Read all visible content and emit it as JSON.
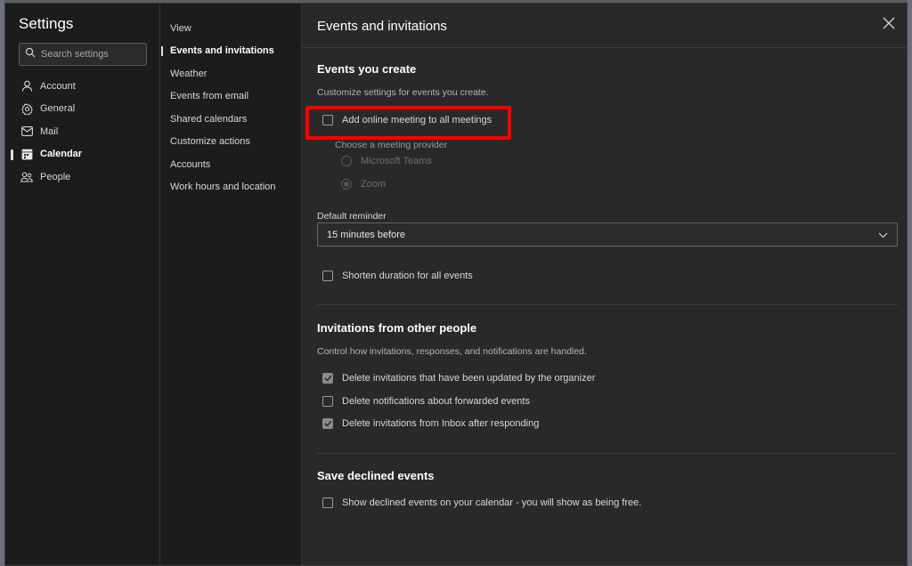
{
  "settings_title": "Settings",
  "search": {
    "placeholder": "Search settings"
  },
  "nav_primary": [
    {
      "label": "Account",
      "icon": "person-icon"
    },
    {
      "label": "General",
      "icon": "gear-icon"
    },
    {
      "label": "Mail",
      "icon": "mail-icon"
    },
    {
      "label": "Calendar",
      "icon": "calendar-icon",
      "active": true
    },
    {
      "label": "People",
      "icon": "people-icon"
    }
  ],
  "nav_secondary": [
    {
      "label": "View"
    },
    {
      "label": "Events and invitations",
      "active": true
    },
    {
      "label": "Weather"
    },
    {
      "label": "Events from email"
    },
    {
      "label": "Shared calendars"
    },
    {
      "label": "Customize actions"
    },
    {
      "label": "Accounts"
    },
    {
      "label": "Work hours and location"
    }
  ],
  "main": {
    "title": "Events and invitations",
    "events_you_create": {
      "title": "Events you create",
      "description": "Customize settings for events you create.",
      "add_online_meeting": {
        "label": "Add online meeting to all meetings",
        "checked": false
      },
      "provider_label": "Choose a meeting provider",
      "providers": [
        {
          "label": "Microsoft Teams",
          "selected": false
        },
        {
          "label": "Zoom",
          "selected": true
        }
      ],
      "default_reminder_label": "Default reminder",
      "default_reminder_value": "15 minutes before",
      "shorten_duration": {
        "label": "Shorten duration for all events",
        "checked": false
      }
    },
    "invitations": {
      "title": "Invitations from other people",
      "description": "Control how invitations, responses, and notifications are handled.",
      "options": [
        {
          "label": "Delete invitations that have been updated by the organizer",
          "checked": true
        },
        {
          "label": "Delete notifications about forwarded events",
          "checked": false
        },
        {
          "label": "Delete invitations from Inbox after responding",
          "checked": true
        }
      ]
    },
    "declined": {
      "title": "Save declined events",
      "option": {
        "label": "Show declined events on your calendar - you will show as being free.",
        "checked": false
      }
    }
  },
  "colors": {
    "highlight": "#ff0000",
    "background": "#292929",
    "sidebar": "#1c1c1c"
  }
}
